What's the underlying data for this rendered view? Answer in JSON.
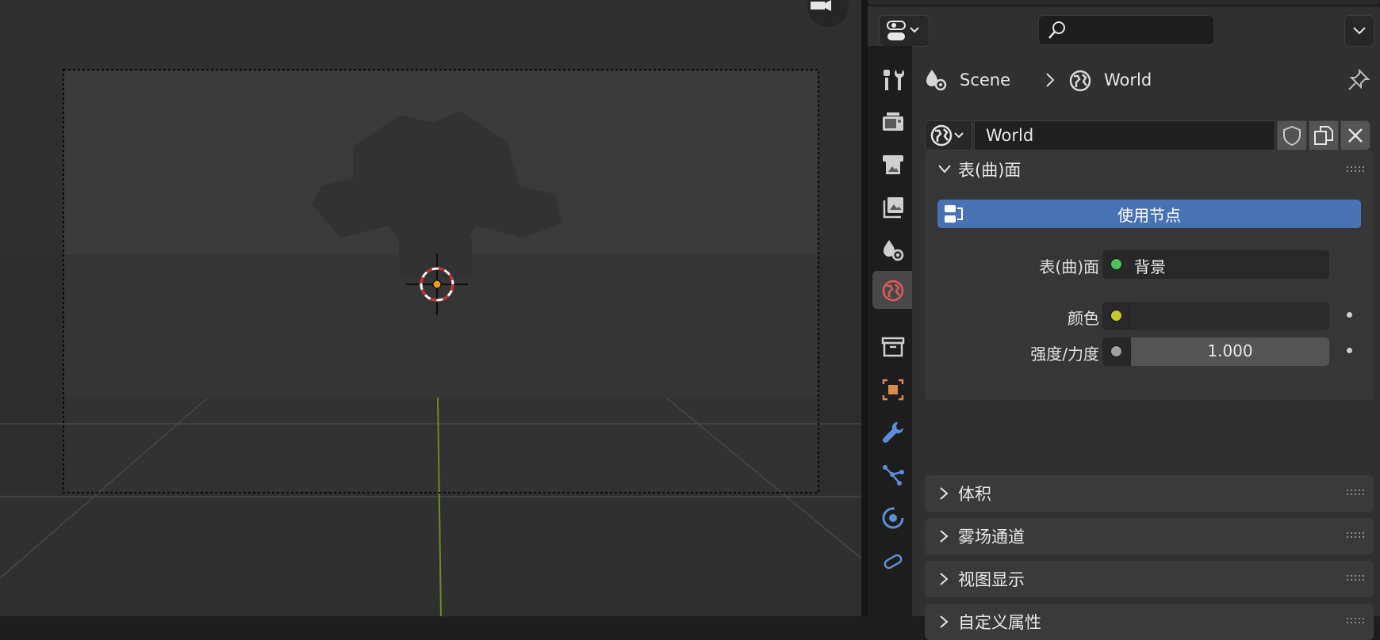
{
  "viewport": {
    "gizmo_icon": "camera-toggle-icon",
    "camera_frame": "camera-border",
    "object": "monkey-silhouette",
    "cursor_icon": "3d-cursor-icon"
  },
  "properties": {
    "header": {
      "editor_type_icon": "properties-editor-icon",
      "search_icon": "search-icon",
      "search_value": "",
      "options_icon": "chevron-down-icon"
    },
    "tabs": [
      {
        "name": "tab-tool",
        "icon": "tool-icon",
        "active": false
      },
      {
        "name": "tab-render",
        "icon": "render-icon",
        "active": false
      },
      {
        "name": "tab-output",
        "icon": "output-icon",
        "active": false
      },
      {
        "name": "tab-view-layer",
        "icon": "view-layer-icon",
        "active": false
      },
      {
        "name": "tab-scene",
        "icon": "scene-icon",
        "active": false
      },
      {
        "name": "tab-world",
        "icon": "world-icon",
        "active": true
      },
      {
        "name": "tab-collection",
        "icon": "collection-icon",
        "active": false
      },
      {
        "name": "tab-object",
        "icon": "object-icon",
        "active": false
      },
      {
        "name": "tab-modifiers",
        "icon": "wrench-icon",
        "active": false
      },
      {
        "name": "tab-particles",
        "icon": "particles-icon",
        "active": false
      },
      {
        "name": "tab-physics",
        "icon": "physics-icon",
        "active": false
      },
      {
        "name": "tab-constraints",
        "icon": "constraints-icon",
        "active": false
      }
    ],
    "breadcrumb": {
      "scene_label": "Scene",
      "world_label": "World"
    },
    "world_datablock": {
      "name": "World"
    },
    "surface_panel": {
      "title": "表(曲)面",
      "use_nodes_label": "使用节点",
      "rows": {
        "surface": {
          "label": "表(曲)面",
          "value": "背景",
          "socket_color": "#4fc45b"
        },
        "color": {
          "label": "颜色",
          "value": "",
          "socket_color": "#c7c729",
          "swatch": "#282828"
        },
        "strength": {
          "label": "强度/力度",
          "value": "1.000",
          "socket_color": "#a1a1a1"
        }
      }
    },
    "collapsed_panels": {
      "volume": "体积",
      "mist": "雾场通道",
      "viewport_display": "视图显示",
      "custom_props": "自定义属性"
    }
  },
  "colors": {
    "accent": "#4772b3",
    "world_tab_icon": "#e05a5a",
    "background": "#303030"
  }
}
